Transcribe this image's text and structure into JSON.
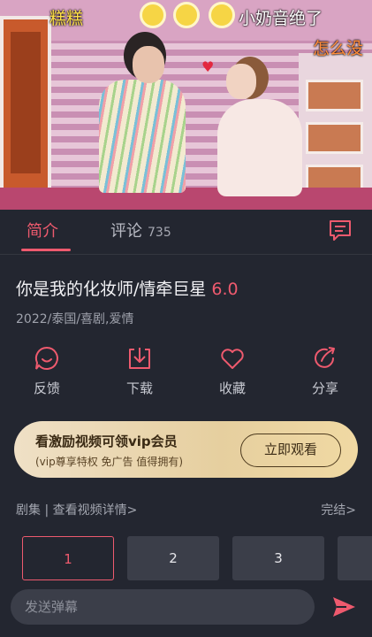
{
  "video": {
    "caption_left": "糕糕",
    "caption_right": "小奶音绝了",
    "caption_right2": "怎么没"
  },
  "tabs": [
    {
      "label": "简介",
      "active": true
    },
    {
      "label": "评论",
      "count": "735",
      "active": false
    }
  ],
  "show": {
    "title": "你是我的化妆师/情牵巨星",
    "score": "6.0",
    "meta": "2022/泰国/喜剧,爱情"
  },
  "actions": [
    {
      "label": "反馈",
      "icon": "feedback-icon"
    },
    {
      "label": "下载",
      "icon": "download-icon"
    },
    {
      "label": "收藏",
      "icon": "heart-icon"
    },
    {
      "label": "分享",
      "icon": "share-icon"
    }
  ],
  "vip_banner": {
    "title": "看激励视频可领vip会员",
    "subtitle": "(vip尊享特权 免广告 值得拥有)",
    "button": "立即观看"
  },
  "episodes": {
    "header": "剧集 | 查看视频详情>",
    "status": "完结>",
    "items": [
      "1",
      "2",
      "3"
    ],
    "selected": "1"
  },
  "bottom": {
    "danmu_placeholder": "发送弹幕"
  },
  "colors": {
    "accent": "#ee5a6e",
    "background": "#232630",
    "chip": "#3b3e49",
    "vip_gold": "#e6cf9f"
  }
}
